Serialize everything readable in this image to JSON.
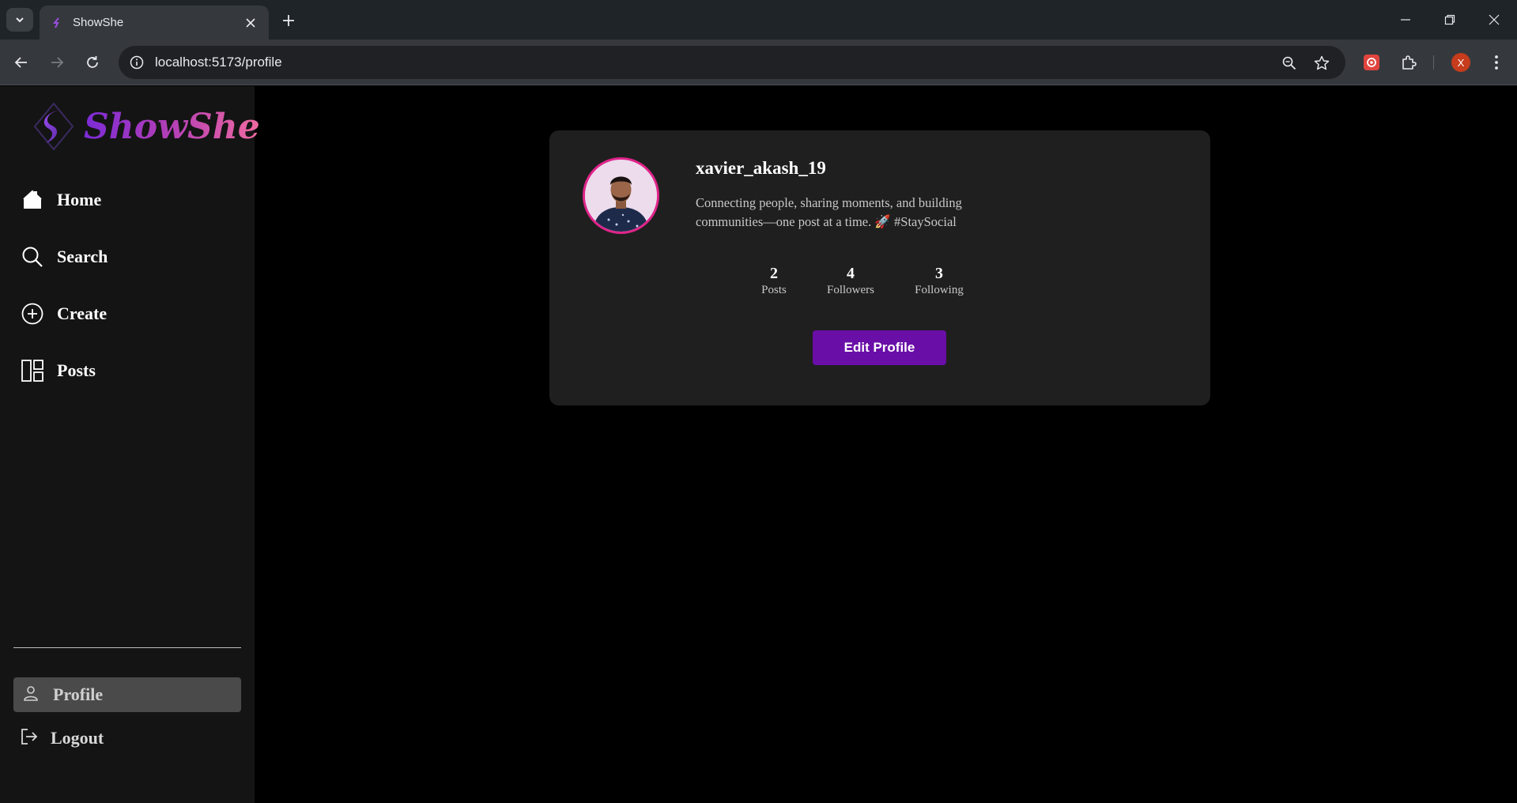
{
  "browser": {
    "tab_title": "ShowShe",
    "url": "localhost:5173/profile",
    "profile_initial": "X"
  },
  "sidebar": {
    "logo_text": "ShowShe",
    "items": [
      {
        "label": "Home",
        "icon": "home-icon"
      },
      {
        "label": "Search",
        "icon": "search-icon"
      },
      {
        "label": "Create",
        "icon": "plus-circle-icon"
      },
      {
        "label": "Posts",
        "icon": "posts-grid-icon"
      }
    ],
    "profile_label": "Profile",
    "logout_label": "Logout"
  },
  "profile": {
    "username": "xavier_akash_19",
    "bio_line1": "Connecting people, sharing moments, and building",
    "bio_line2": "communities—one post at a time. 🚀 #StaySocial",
    "stats": [
      {
        "value": "2",
        "label": "Posts"
      },
      {
        "value": "4",
        "label": "Followers"
      },
      {
        "value": "3",
        "label": "Following"
      }
    ],
    "edit_button": "Edit Profile"
  },
  "colors": {
    "accent": "#6a0ea8",
    "avatar_ring": "#e0248a",
    "sidebar_bg": "#141414",
    "card_bg": "#1f1f1f"
  }
}
